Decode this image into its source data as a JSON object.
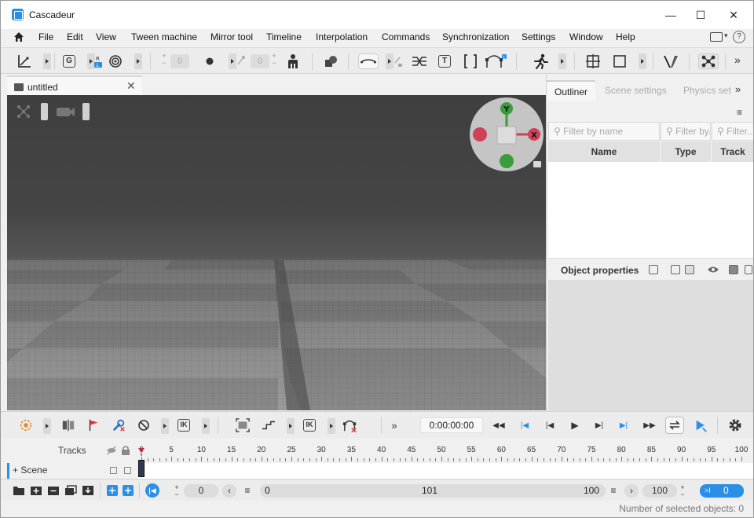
{
  "window": {
    "title": "Cascadeur",
    "minimize_glyph": "—",
    "maximize_glyph": "☐",
    "close_glyph": "✕"
  },
  "menu": [
    "File",
    "Edit",
    "View",
    "Tween machine",
    "Mirror tool",
    "Timeline",
    "Interpolation",
    "Commands",
    "Synchronization",
    "Settings",
    "Window",
    "Help"
  ],
  "toolbar": {
    "g_label": "G",
    "field_a": "0",
    "field_b": "0",
    "t_label": "T",
    "more": "»"
  },
  "viewport": {
    "tab_label": "untitled",
    "tab_close": "✕",
    "gizmo": {
      "x_label": "X",
      "y_label": "Y"
    },
    "background_color": "#444444"
  },
  "panel": {
    "tabs": [
      "Outliner",
      "Scene settings",
      "Physics set"
    ],
    "tabs_more": "»",
    "menu_glyph": "≡",
    "filters": [
      "Filter by name",
      "Filter by...",
      "Filter..."
    ],
    "columns": [
      "Name",
      "Type",
      "Track"
    ],
    "object_properties_title": "Object properties"
  },
  "bottom_toolbar": {
    "ik_label": "IK",
    "ik_label_2": "IK",
    "more": "»",
    "time": "0:00:00:00"
  },
  "timeline": {
    "tracks_label": "Tracks",
    "scene_label": "+ Scene",
    "ticks": [
      "0",
      "5",
      "10",
      "15",
      "20",
      "25",
      "30",
      "35",
      "40",
      "45",
      "50",
      "55",
      "60",
      "65",
      "70",
      "75",
      "80",
      "85",
      "90",
      "95",
      "100"
    ]
  },
  "bottom_bar": {
    "current_frame": "0",
    "range_start": "0",
    "range_center": "101",
    "range_end": "100",
    "end_frame": "100",
    "selected_range": "0"
  },
  "status": {
    "text": "Number of selected objects: 0"
  },
  "colors": {
    "accent": "#2b8fe6",
    "gizmo_x": "#e0405a",
    "gizmo_y": "#3aa63a",
    "flag_red": "#e0303a"
  }
}
